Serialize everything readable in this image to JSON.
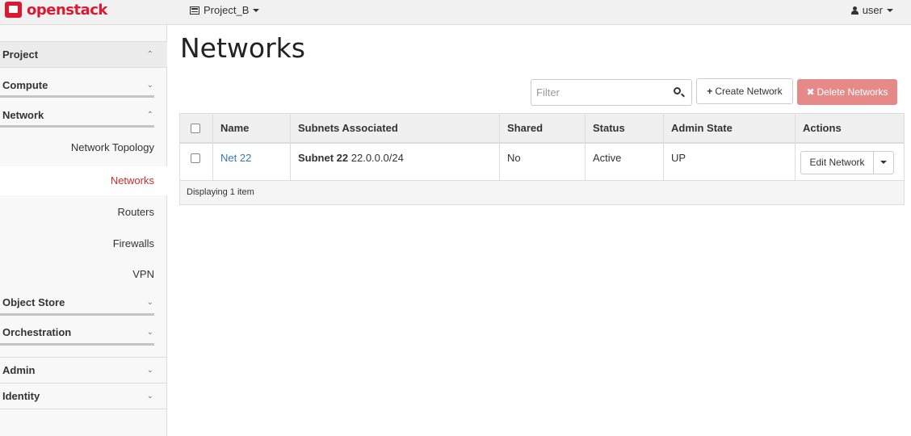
{
  "topbar": {
    "brand": "openstack",
    "project": "Project_B",
    "user": "user"
  },
  "sidebar": {
    "categories": [
      {
        "label": "Project",
        "state": "expanded"
      },
      {
        "label": "Compute",
        "state": "collapsed"
      },
      {
        "label": "Network",
        "state": "expanded"
      },
      {
        "label": "Object Store",
        "state": "collapsed"
      },
      {
        "label": "Orchestration",
        "state": "collapsed"
      },
      {
        "label": "Admin",
        "state": "collapsed"
      },
      {
        "label": "Identity",
        "state": "collapsed"
      }
    ],
    "network_items": [
      "Network Topology",
      "Networks",
      "Routers",
      "Firewalls",
      "VPN"
    ],
    "active_item": "Networks"
  },
  "main": {
    "title": "Networks",
    "filter_placeholder": "Filter",
    "create_label": "Create Network",
    "delete_label": "Delete Networks",
    "table": {
      "columns": [
        "Name",
        "Subnets Associated",
        "Shared",
        "Status",
        "Admin State",
        "Actions"
      ],
      "rows": [
        {
          "name": "Net 22",
          "subnet_name": "Subnet 22",
          "subnet_cidr": "22.0.0.0/24",
          "shared": "No",
          "status": "Active",
          "admin_state": "UP",
          "action": "Edit Network"
        }
      ],
      "footer": "Displaying 1 item"
    }
  },
  "colors": {
    "brand_red": "#da1a32",
    "active_nav": "#c9302c",
    "link": "#337ab7",
    "delete_button": "#e58a89"
  }
}
